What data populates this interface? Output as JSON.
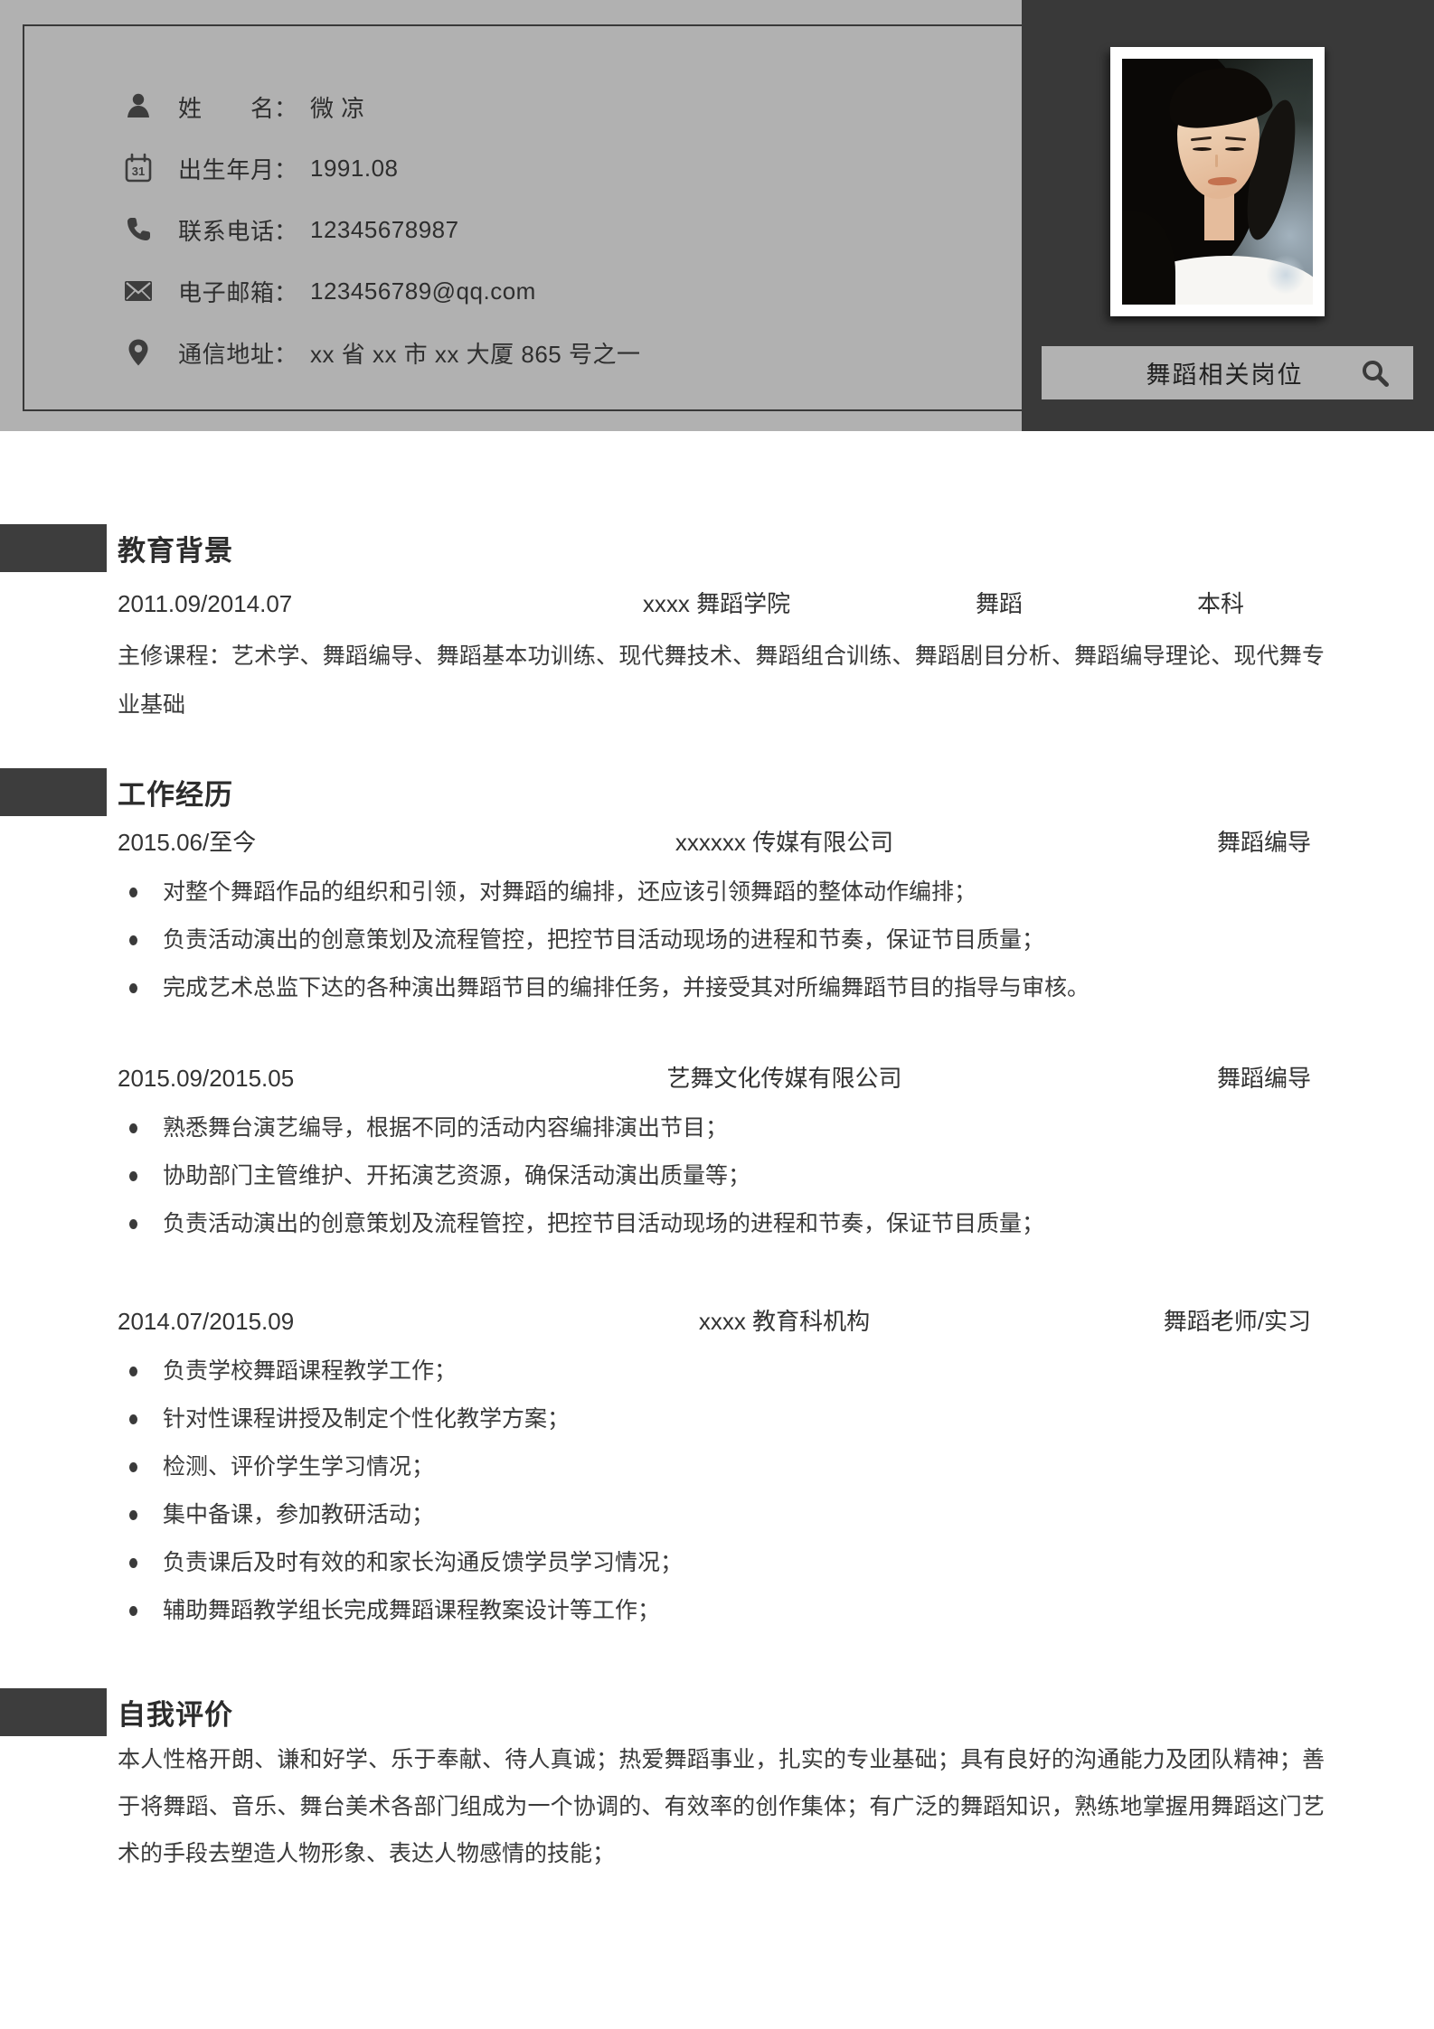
{
  "header": {
    "colon": "：",
    "calendar_day": "31",
    "contact": [
      {
        "icon": "person-icon",
        "label": "姓名",
        "value": "微 凉"
      },
      {
        "icon": "calendar-icon",
        "label": "出生年月",
        "value": "1991.08"
      },
      {
        "icon": "phone-icon",
        "label": "联系电话",
        "value": "12345678987"
      },
      {
        "icon": "email-icon",
        "label": "电子邮箱",
        "value": "123456789@qq.com"
      },
      {
        "icon": "location-icon",
        "label": "通信地址",
        "value": "xx 省 xx 市 xx 大厦 865 号之一"
      }
    ],
    "search": {
      "text": "舞蹈相关岗位",
      "icon": "search-icon"
    }
  },
  "colors": {
    "header_gray": "#b1b1b1",
    "panel_dark": "#393939",
    "tab_dark": "#3d3d3d",
    "text_dark": "#3a3a3a"
  },
  "sections": {
    "education": {
      "title": "教育背景",
      "period": "2011.09/2014.07",
      "school": "xxxx 舞蹈学院",
      "major": "舞蹈",
      "degree": "本科",
      "courses": "主修课程：艺术学、舞蹈编导、舞蹈基本功训练、现代舞技术、舞蹈组合训练、舞蹈剧目分析、舞蹈编导理论、现代舞专业基础"
    },
    "work": {
      "title": "工作经历",
      "jobs": [
        {
          "period": "2015.06/至今",
          "company": "xxxxxx 传媒有限公司",
          "role": "舞蹈编导",
          "bullets": [
            "对整个舞蹈作品的组织和引领，对舞蹈的编排，还应该引领舞蹈的整体动作编排；",
            "负责活动演出的创意策划及流程管控，把控节目活动现场的进程和节奏，保证节目质量；",
            "完成艺术总监下达的各种演出舞蹈节目的编排任务，并接受其对所编舞蹈节目的指导与审核。"
          ]
        },
        {
          "period": "2015.09/2015.05",
          "company": "艺舞文化传媒有限公司",
          "role": "舞蹈编导",
          "bullets": [
            "熟悉舞台演艺编导，根据不同的活动内容编排演出节目；",
            "协助部门主管维护、开拓演艺资源，确保活动演出质量等；",
            "负责活动演出的创意策划及流程管控，把控节目活动现场的进程和节奏，保证节目质量；"
          ]
        },
        {
          "period": "2014.07/2015.09",
          "company": "xxxx 教育科机构",
          "role": "舞蹈老师/实习",
          "bullets": [
            "负责学校舞蹈课程教学工作；",
            "针对性课程讲授及制定个性化教学方案；",
            "检测、评价学生学习情况；",
            "集中备课，参加教研活动；",
            "负责课后及时有效的和家长沟通反馈学员学习情况；",
            "辅助舞蹈教学组长完成舞蹈课程教案设计等工作；"
          ]
        }
      ]
    },
    "self_evaluation": {
      "title": "自我评价",
      "text": "本人性格开朗、谦和好学、乐于奉献、待人真诚；热爱舞蹈事业，扎实的专业基础；具有良好的沟通能力及团队精神；善于将舞蹈、音乐、舞台美术各部门组成为一个协调的、有效率的创作集体；有广泛的舞蹈知识，熟练地掌握用舞蹈这门艺术的手段去塑造人物形象、表达人物感情的技能；"
    }
  }
}
